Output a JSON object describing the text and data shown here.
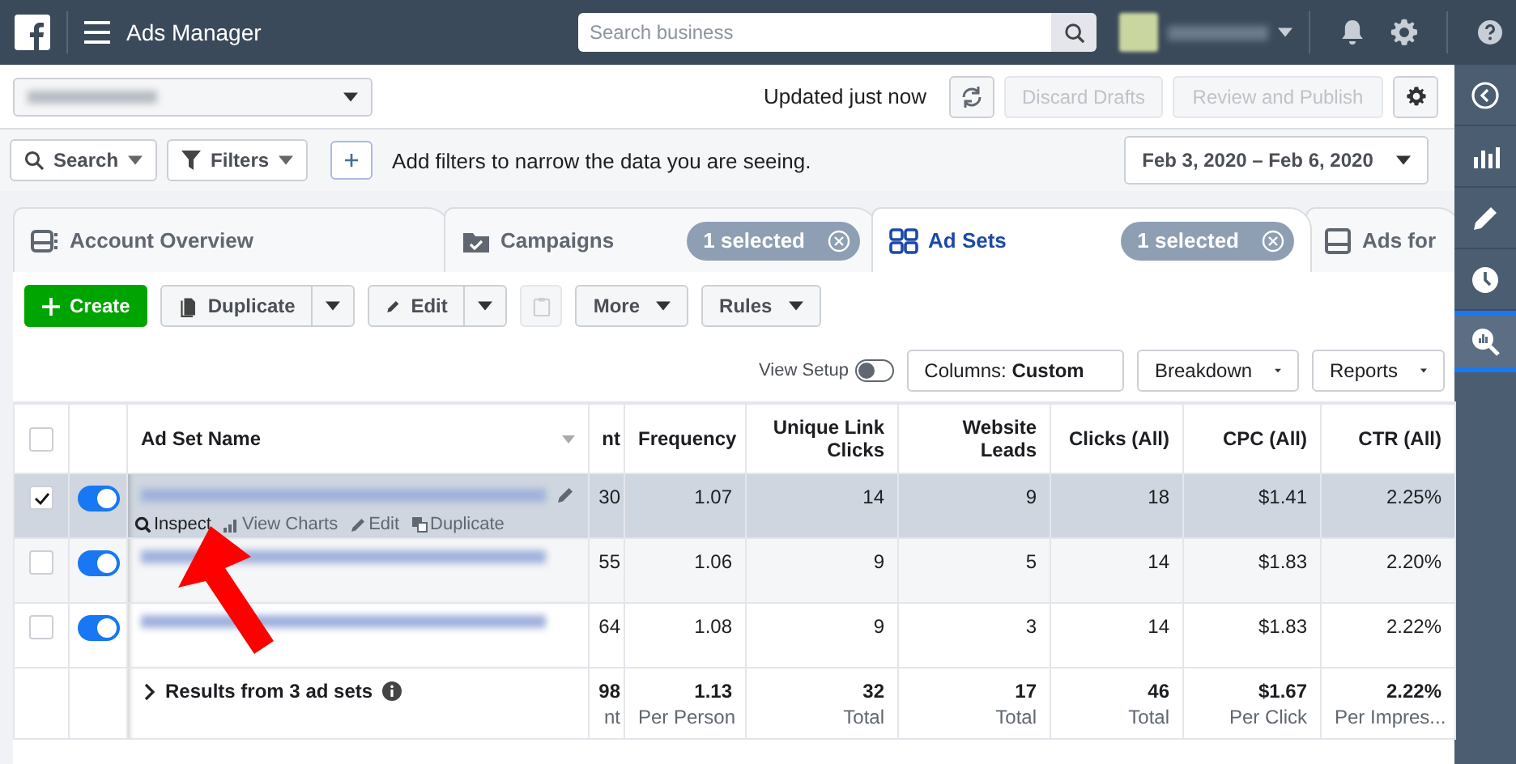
{
  "top_bar": {
    "title": "Ads Manager",
    "search": {
      "placeholder": "Search business"
    }
  },
  "account_bar": {
    "status": "Updated just now",
    "buttons": [
      {
        "label": "Discard Drafts",
        "disabled": true
      },
      {
        "label": "Review and Publish",
        "disabled": true
      }
    ]
  },
  "filter_bar": {
    "buttons": [
      "Search",
      "Filters"
    ],
    "hint": "Add filters to narrow the data you are seeing.",
    "date_range": "Feb 3, 2020 – Feb 6, 2020"
  },
  "tabs": [
    {
      "kind": "overview",
      "label": "Account Overview",
      "selected": false
    },
    {
      "kind": "campaigns",
      "label": "Campaigns",
      "badge": "1 selected",
      "selected": false
    },
    {
      "kind": "adsets",
      "label": "Ad Sets",
      "badge": "1 selected",
      "selected": true
    },
    {
      "kind": "ads",
      "label": "Ads for",
      "selected": false
    }
  ],
  "toolbar": [
    {
      "kind": "primary",
      "label": "Create"
    },
    {
      "kind": "duplicate",
      "label": "Duplicate"
    },
    {
      "kind": "edit",
      "label": "Edit"
    },
    {
      "kind": "icon",
      "disabled": true
    },
    {
      "kind": "menu",
      "label": "More"
    },
    {
      "kind": "menu",
      "label": "Rules"
    }
  ],
  "view_bar": {
    "view_setup": {
      "label": "View Setup",
      "on": false
    },
    "columns": {
      "label": "Columns:",
      "value": "Custom"
    },
    "buttons": [
      "Breakdown",
      "Reports"
    ]
  },
  "table": {
    "all_checked": false,
    "columns": [
      "Ad Set Name",
      "nt",
      "Frequency",
      "Unique Link Clicks",
      "Website Leads",
      "Clicks (All)",
      "CPC (All)",
      "CTR (All)"
    ],
    "rows": [
      {
        "checked": true,
        "on": true,
        "selected": true,
        "cells": [
          "",
          "30",
          "1.07",
          "14",
          "9",
          "18",
          "$1.41",
          "2.25%"
        ],
        "actions": [
          "Inspect",
          "View Charts",
          "Edit",
          "Duplicate"
        ]
      },
      {
        "checked": false,
        "on": true,
        "selected": false,
        "cells": [
          "",
          "55",
          "1.06",
          "9",
          "5",
          "14",
          "$1.83",
          "2.20%"
        ]
      },
      {
        "checked": false,
        "on": true,
        "selected": false,
        "cells": [
          "",
          "64",
          "1.08",
          "9",
          "3",
          "14",
          "$1.83",
          "2.22%"
        ]
      }
    ],
    "totals": {
      "label": "Results from 3 ad sets",
      "cells": [
        {
          "value": "98",
          "sub": "nt"
        },
        {
          "value": "1.13",
          "sub": "Per Person"
        },
        {
          "value": "32",
          "sub": "Total"
        },
        {
          "value": "17",
          "sub": "Total"
        },
        {
          "value": "46",
          "sub": "Total"
        },
        {
          "value": "$1.67",
          "sub": "Per Click"
        },
        {
          "value": "2.22%",
          "sub": "Per Impres..."
        }
      ]
    }
  },
  "rail": [
    {
      "kind": "collapse",
      "selected": false
    },
    {
      "kind": "chart",
      "selected": false
    },
    {
      "kind": "edit",
      "selected": false
    },
    {
      "kind": "history",
      "selected": false
    },
    {
      "kind": "inspect",
      "selected": true
    }
  ]
}
